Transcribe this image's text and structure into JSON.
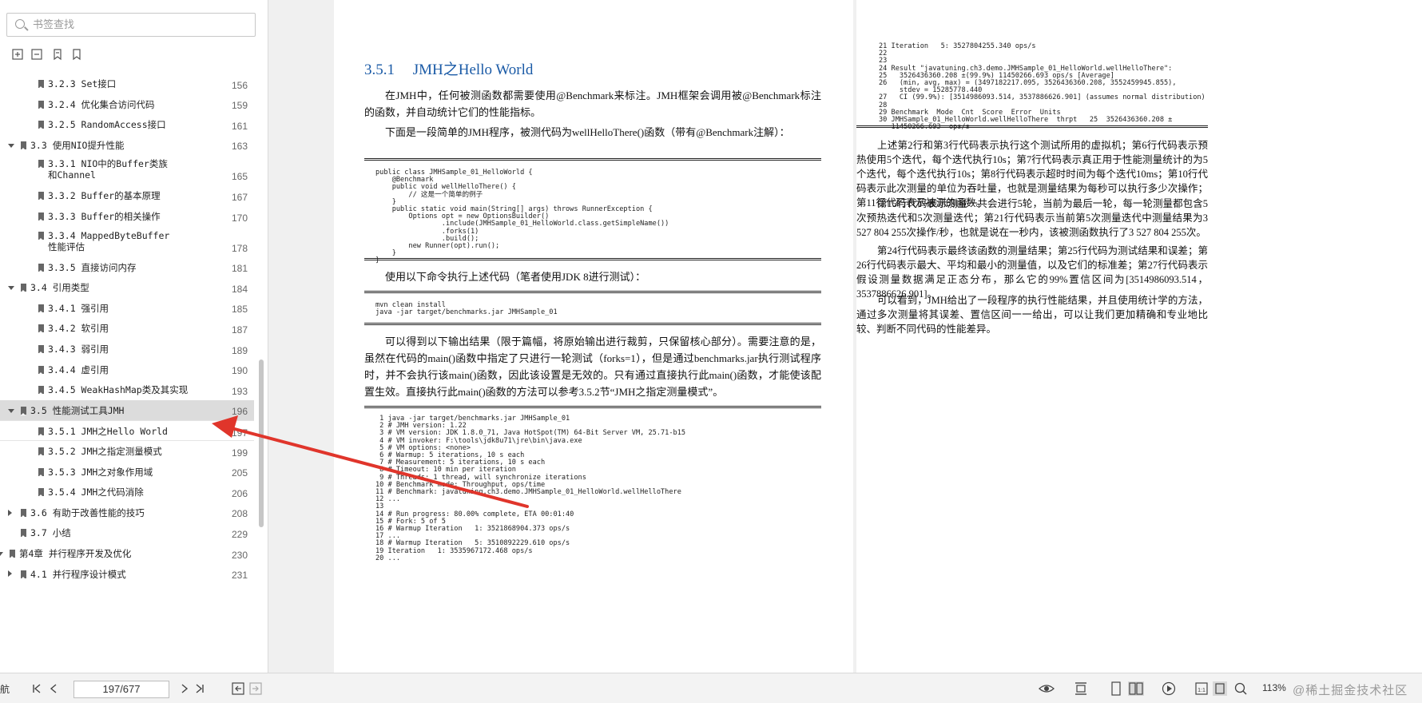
{
  "sidebar": {
    "search_placeholder": "书签查找",
    "toolbar_icons": [
      "expand-all-icon",
      "collapse-all-icon",
      "add-bookmark-icon",
      "bookmark-icon"
    ],
    "toc": [
      {
        "label": "3.2.3 Set接口",
        "page": "156",
        "level": 3,
        "expander": "none"
      },
      {
        "label": "3.2.4 优化集合访问代码",
        "page": "159",
        "level": 3,
        "expander": "none"
      },
      {
        "label": "3.2.5 RandomAccess接口",
        "page": "161",
        "level": 3,
        "expander": "none"
      },
      {
        "label": "3.3 使用NIO提升性能",
        "page": "163",
        "level": 2,
        "expander": "open"
      },
      {
        "label": "3.3.1 NIO中的Buffer类族和Channel",
        "page": "165",
        "level": 3,
        "expander": "none"
      },
      {
        "label": "3.3.2 Buffer的基本原理",
        "page": "167",
        "level": 3,
        "expander": "none"
      },
      {
        "label": "3.3.3 Buffer的相关操作",
        "page": "170",
        "level": 3,
        "expander": "none"
      },
      {
        "label": "3.3.4 MappedByteBuffer性能评估",
        "page": "178",
        "level": 3,
        "expander": "none"
      },
      {
        "label": "3.3.5 直接访问内存",
        "page": "181",
        "level": 3,
        "expander": "none"
      },
      {
        "label": "3.4 引用类型",
        "page": "184",
        "level": 2,
        "expander": "open"
      },
      {
        "label": "3.4.1 强引用",
        "page": "185",
        "level": 3,
        "expander": "none"
      },
      {
        "label": "3.4.2 软引用",
        "page": "187",
        "level": 3,
        "expander": "none"
      },
      {
        "label": "3.4.3 弱引用",
        "page": "189",
        "level": 3,
        "expander": "none"
      },
      {
        "label": "3.4.4 虚引用",
        "page": "190",
        "level": 3,
        "expander": "none"
      },
      {
        "label": "3.4.5 WeakHashMap类及其实现",
        "page": "193",
        "level": 3,
        "expander": "none"
      },
      {
        "label": "3.5 性能测试工具JMH",
        "page": "196",
        "level": 2,
        "expander": "open",
        "selected": true
      },
      {
        "label": "3.5.1 JMH之Hello World",
        "page": "197",
        "level": 3,
        "expander": "none",
        "current": true
      },
      {
        "label": "3.5.2 JMH之指定测量模式",
        "page": "199",
        "level": 3,
        "expander": "none"
      },
      {
        "label": "3.5.3 JMH之对象作用域",
        "page": "205",
        "level": 3,
        "expander": "none"
      },
      {
        "label": "3.5.4 JMH之代码消除",
        "page": "206",
        "level": 3,
        "expander": "none"
      },
      {
        "label": "3.6 有助于改善性能的技巧",
        "page": "208",
        "level": 2,
        "expander": "closed"
      },
      {
        "label": "3.7 小结",
        "page": "229",
        "level": 2,
        "expander": "none"
      },
      {
        "label": "第4章 并行程序开发及优化",
        "page": "230",
        "level": 1,
        "expander": "open"
      },
      {
        "label": "4.1 并行程序设计模式",
        "page": "231",
        "level": 2,
        "expander": "closed"
      }
    ]
  },
  "left_page": {
    "heading_num": "3.5.1",
    "heading_text": "JMH之Hello World",
    "p1": "在JMH中，任何被测函数都需要使用@Benchmark来标注。JMH框架会调用被@Benchmark标注的函数，并自动统计它们的性能指标。",
    "p2": "下面是一段简单的JMH程序，被测代码为wellHelloThere()函数（带有@Benchmark注解）：",
    "code1": "public class JMHSample_01_HelloWorld {\n    @Benchmark\n    public void wellHelloThere() {\n        // 这是一个简单的例子\n    }\n    public static void main(String[] args) throws RunnerException {\n        Options opt = new OptionsBuilder()\n                .include(JMHSample_01_HelloWorld.class.getSimpleName())\n                .forks(1)\n                .build();\n        new Runner(opt).run();\n    }\n}",
    "p3": "使用以下命令执行上述代码（笔者使用JDK 8进行测试）：",
    "code2": "mvn clean install\njava -jar target/benchmarks.jar JMHSample_01",
    "p4": "可以得到以下输出结果（限于篇幅，将原始输出进行裁剪，只保留核心部分）。需要注意的是，虽然在代码的main()函数中指定了只进行一轮测试（forks=1），但是通过benchmarks.jar执行测试程序时，并不会执行该main()函数，因此该设置是无效的。只有通过直接执行此main()函数，才能使该配置生效。直接执行此main()函数的方法可以参考3.5.2节“JMH之指定测量模式”。",
    "code3": " 1 java -jar target/benchmarks.jar JMHSample_01\n 2 # JMH version: 1.22\n 3 # VM version: JDK 1.8.0_71, Java HotSpot(TM) 64-Bit Server VM, 25.71-b15\n 4 # VM invoker: F:\\tools\\jdk8u71\\jre\\bin\\java.exe\n 5 # VM options: <none>\n 6 # Warmup: 5 iterations, 10 s each\n 7 # Measurement: 5 iterations, 10 s each\n 8 # Timeout: 10 min per iteration\n 9 # Threads: 1 thread, will synchronize iterations\n10 # Benchmark mode: Throughput, ops/time\n11 # Benchmark: javatuning.ch3.demo.JMHSample_01_HelloWorld.wellHelloThere\n12 ...\n13\n14 # Run progress: 80.00% complete, ETA 00:01:40\n15 # Fork: 5 of 5\n16 # Warmup Iteration   1: 3521868904.373 ops/s\n17 ...\n18 # Warmup Iteration   5: 3510892229.610 ops/s\n19 Iteration   1: 3535967172.468 ops/s\n20 ..."
  },
  "right_page": {
    "code4": "21 Iteration   5: 3527804255.340 ops/s\n22\n23\n24 Result \"javatuning.ch3.demo.JMHSample_01_HelloWorld.wellHelloThere\":\n25   3526436360.208 ±(99.9%) 11450266.693 ops/s [Average]\n26   (min, avg, max) = (3497182217.095, 3526436360.208, 3552459945.855),\n     stdev = 15285778.440\n27   CI (99.9%): [3514986093.514, 3537886626.901] (assumes normal distribution)\n28\n29 Benchmark  Mode  Cnt  Score  Error  Units\n30 JMHSample_01_HelloWorld.wellHelloThere  thrpt   25  3526436360.208 ±\n   11450266.693  ops/s",
    "p5": "上述第2行和第3行代码表示执行这个测试所用的虚拟机；第6行代码表示预热使用5个迭代，每个迭代执行10s；第7行代码表示真正用于性能测量统计的为5个迭代，每个迭代执行10s；第8行代码表示超时时间为每个迭代10ms；第10行代码表示此次测量的单位为吞吐量，也就是测量结果为每秒可以执行多少次操作；第11行代码表示被测的函数。",
    "p6": "第15行代码表示测量一共会进行5轮，当前为最后一轮，每一轮测量都包含5次预热迭代和5次测量迭代；第21行代码表示当前第5次测量迭代中测量结果为3 527 804 255次操作/秒，也就是说在一秒内，该被测函数执行了3 527 804 255次。",
    "p7": "第24行代码表示最终该函数的测量结果；第25行代码为测试结果和误差；第26行代码表示最大、平均和最小的测量值，以及它们的标准差；第27行代码表示假设测量数据满足正态分布，那么它的99%置信区间为[3514986093.514，3537886626.901]。",
    "p8": "可以看到，JMH给出了一段程序的执行性能结果，并且使用统计学的方法，通过多次测量将其误差、置信区间一一给出，可以让我们更加精确和专业地比较、判断不同代码的性能差异。"
  },
  "bottombar": {
    "nav_label": "航",
    "page_indicator": "197/677",
    "zoom": "113%",
    "watermark": "@稀土掘金技术社区"
  },
  "colors": {
    "heading": "#1a5aa6",
    "annotation_arrow": "#e0352b",
    "selection": "#dcdcdc"
  }
}
